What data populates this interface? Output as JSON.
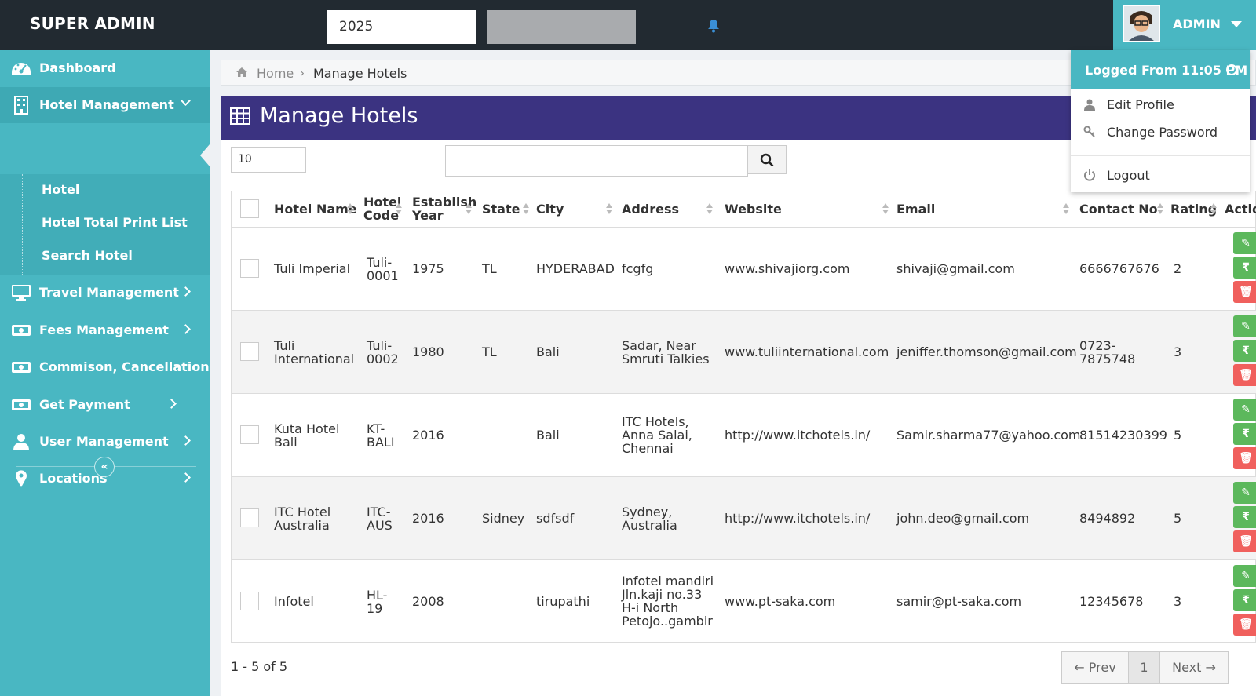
{
  "topbar": {
    "brand": "SUPER ADMIN",
    "year_value": "2025",
    "bell_icon": "bell-icon",
    "admin_label": "ADMIN"
  },
  "sidebar": {
    "items": [
      {
        "label": "Dashboard",
        "icon": "dashboard-icon"
      },
      {
        "label": "Hotel Management",
        "icon": "building-icon"
      },
      {
        "label": "Travel Management",
        "icon": "monitor-icon"
      },
      {
        "label": "Fees Management",
        "icon": "money-icon"
      },
      {
        "label": "Commison, Cancellation",
        "icon": "money-icon"
      },
      {
        "label": "Get Payment",
        "icon": "money-icon"
      },
      {
        "label": "User Management",
        "icon": "user-icon"
      },
      {
        "label": "Locations",
        "icon": "map-marker-icon"
      }
    ],
    "submenu": [
      "Hotel",
      "Hotel Total Print List",
      "Search Hotel"
    ],
    "collapse_glyph": "«"
  },
  "breadcrumb": {
    "home": "Home",
    "separator": "›",
    "current": "Manage Hotels"
  },
  "page": {
    "title": "Manage Hotels",
    "per_page": "10",
    "search_placeholder": ""
  },
  "table": {
    "headers": {
      "hotel_name": "Hotel Name",
      "hotel_code_1": "Hotel",
      "hotel_code_2": "Code",
      "establish_1": "Establish",
      "establish_2": "Year",
      "state": "State",
      "city": "City",
      "address": "Address",
      "website": "Website",
      "email": "Email",
      "contact": "Contact No",
      "rating": "Rating",
      "action": "Actio"
    },
    "rows": [
      {
        "name": "Tuli Imperial",
        "code": "Tuli-\n0001",
        "year": "1975",
        "state": "TL",
        "city": "HYDERABAD",
        "address": "fcgfg",
        "website": "www.shivajiorg.com",
        "email": "shivaji@gmail.com",
        "contact": "6666767676",
        "rating": "2"
      },
      {
        "name": "Tuli\nInternational",
        "code": "Tuli-\n0002",
        "year": "1980",
        "state": "TL",
        "city": "Bali",
        "address": "Sadar, Near\nSmruti Talkies",
        "website": "www.tuliinternational.com",
        "email": "jeniffer.thomson@gmail.com",
        "contact": "0723-\n7875748",
        "rating": "3"
      },
      {
        "name": "Kuta Hotel\nBali",
        "code": "KT-\nBALI",
        "year": "2016",
        "state": "",
        "city": "Bali",
        "address": "ITC Hotels,\nAnna Salai,\nChennai",
        "website": "http://www.itchotels.in/",
        "email": "Samir.sharma77@yahoo.com",
        "contact": "81514230399",
        "rating": "5"
      },
      {
        "name": "ITC Hotel\nAustralia",
        "code": "ITC-\nAUS",
        "year": "2016",
        "state": "Sidney",
        "city": "sdfsdf",
        "address": "Sydney,\nAustralia",
        "website": "http://www.itchotels.in/",
        "email": "john.deo@gmail.com",
        "contact": "8494892",
        "rating": "5"
      },
      {
        "name": "Infotel",
        "code": "HL-\n19",
        "year": "2008",
        "state": "",
        "city": "tirupathi",
        "address": "Infotel mandiri\nJln.kaji no.33\nH-i North\nPetojo..gambir",
        "website": "www.pt-saka.com",
        "email": "samir@pt-saka.com",
        "contact": "12345678",
        "rating": "3"
      }
    ],
    "action_glyphs": {
      "edit": "✎",
      "pay": "₹",
      "delete": "🗑"
    }
  },
  "pagination": {
    "summary": "1 - 5 of 5",
    "prev": "← Prev",
    "page": "1",
    "next": "Next →"
  },
  "dropdown": {
    "logged_from": "Logged From 11:05 PM",
    "edit_profile": "Edit Profile",
    "change_password": "Change Password",
    "logout": "Logout"
  },
  "colors": {
    "topbar": "#222a31",
    "sidebar": "#49b7c2",
    "header_panel": "#3b3381",
    "edit_green": "#5cb85c",
    "delete_red": "#f0605d"
  }
}
